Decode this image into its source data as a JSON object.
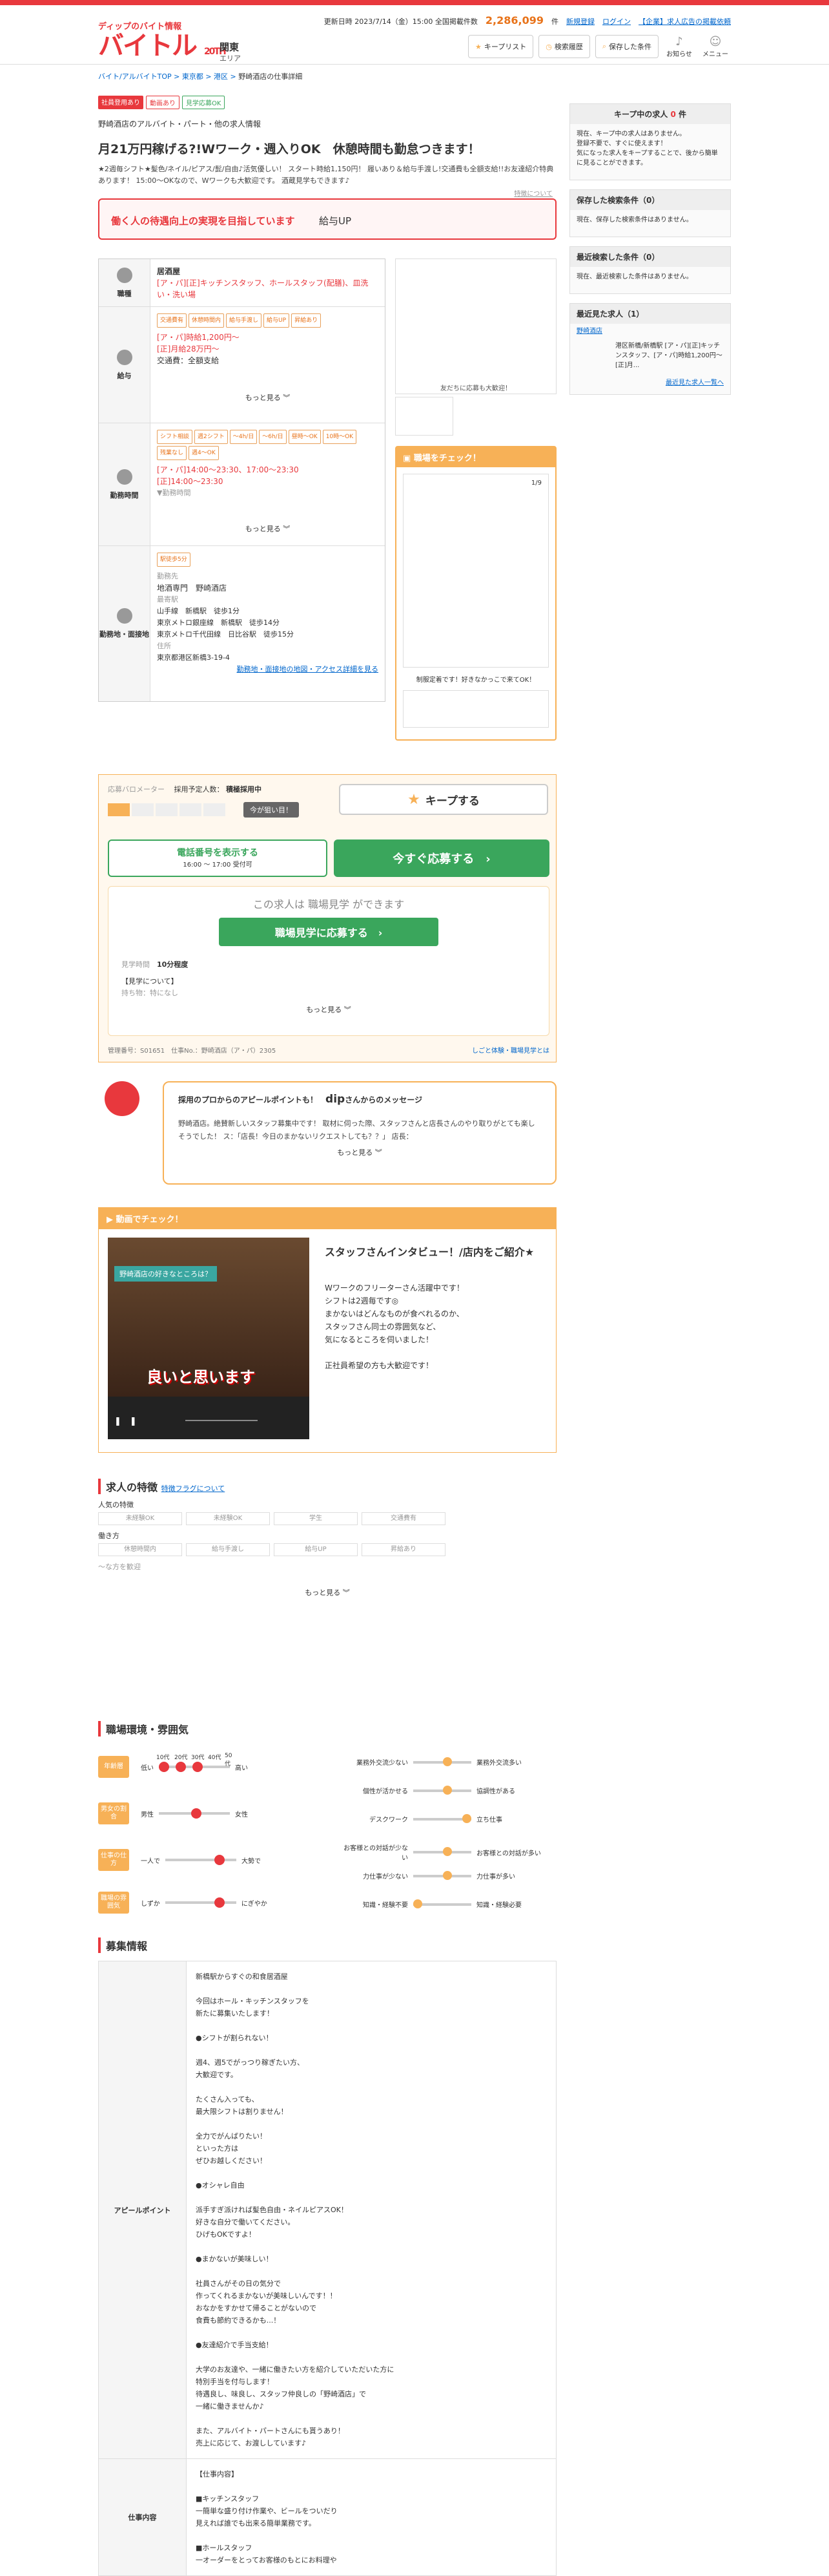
{
  "header": {
    "logo_top": "ディップのバイト情報",
    "logo": "バイトル",
    "logo_sub": "20TH",
    "region": "関東",
    "region_change": "エリア",
    "update_label": "更新日時 2023/7/14（金）15:00 全国掲載件数",
    "count": "2,286,099",
    "count_unit": "件",
    "register": "新規登録",
    "login": "ログイン",
    "corp": "【企業】求人広告の掲載依頼",
    "keep_list": "キープリスト",
    "history": "検索履歴",
    "saved": "保存した条件",
    "notice": "お知らせ",
    "menu": "メニュー"
  },
  "breadcrumb": [
    "バイト/アルバイトTOP",
    "東京都",
    "港区",
    "野崎酒店の仕事詳細"
  ],
  "job": {
    "badges": [
      "社員登用あり",
      "動画あり",
      "見学応募OK"
    ],
    "company": "野崎酒店のアルバイト・パート・他の求人情報",
    "title": "月21万円稼げる?!Wワーク・週入りOK　休憩時間も勤怠つきます！",
    "desc": "★2週毎シフト★髪色/ネイル/ピアス/髭/自由♪活気優しい！ スタート時給1,150円！ 履いあり＆給与手渡し!交通費も全額支給!!お友達紹介特典あります！ 15:00〜OKなので、Wワークも大歓迎です。 酒蔵見学もできます♪",
    "goal_label": "働く人の待遇向上の実現を目指しています",
    "goal_value": "給与UP",
    "goal_link": "特徴について"
  },
  "info": {
    "type_label": "職種",
    "type_tag": "居酒屋",
    "type_value": "[ア・パ][正]キッチンスタッフ、ホールスタッフ(配膳)、皿洗い・洗い場",
    "pay_label": "給与",
    "pay_tags": [
      "交通費有",
      "休憩時間内",
      "給与手渡し",
      "給与UP",
      "昇給あり"
    ],
    "pay_line1": "[ア・パ]時給1,200円〜",
    "pay_line2": "[正]月給28万円〜",
    "pay_line3": "交通費：全額支給",
    "time_label": "勤務時間",
    "time_tags": [
      "シフト相談",
      "週2シフト",
      "〜4h/日",
      "〜6h/日",
      "昼時〜OK",
      "10時〜OK",
      "残業なし",
      "週4〜OK"
    ],
    "time_line1": "[ア・パ]14:00〜23:30、17:00〜23:30",
    "time_line2": "[正]14:00〜23:30",
    "time_line3": "▼勤務時間",
    "place_label": "勤務地・面接地",
    "place_tag": "駅徒歩5分",
    "place_head1": "勤務先",
    "place_name": "地酒専門　野崎酒店",
    "place_head2": "最寄駅",
    "place_st1": "山手線　新橋駅　徒歩1分",
    "place_st2": "東京メトロ銀座線　新橋駅　徒歩14分",
    "place_st3": "東京メトロ千代田線　日比谷駅　徒歩15分",
    "place_head3": "住所",
    "place_addr": "東京都港区新橋3-19-4",
    "place_link": "勤務地・面接地の地図・アクセス詳細を見る",
    "more": "もっと見る"
  },
  "qr": {
    "caption": "友だちに応募も大歓迎！"
  },
  "camera": {
    "title": "職場をチェック！",
    "counter": "1/9",
    "caption": "制服定着です！好きなかっこで来てOK！"
  },
  "sidebar": {
    "keep_title": "キープ中の求人",
    "keep_count": "0",
    "keep_unit": "件",
    "keep_text": "現在、キープ中の求人はありません。\n登録不要で、すぐに使えます！\n気になった求人をキープすることで、後から簡単に見ることができます。",
    "saved_title": "保存した検索条件（0）",
    "saved_text": "現在、保存した検索条件はありません。",
    "recent_cond_title": "最近検索した条件（0）",
    "recent_cond_text": "現在、最近検索した条件はありません。",
    "recent_job_title": "最近見た求人（1）",
    "recent_job_name": "野崎酒店",
    "recent_job_detail": "港区新橋/新橋駅 [ア・パ][正]キッチンスタッフ、[ア・パ]時給1,200円〜[正]月...",
    "recent_job_link": "最近見た求人一覧へ"
  },
  "apply": {
    "meter": "応募バロメーター",
    "plan": "採用予定人数：",
    "plan_value": "積極採用中",
    "hint": "今が狙い目！",
    "keep": "キープする",
    "tel": "電話番号を表示する",
    "tel_time": "16:00 〜 17:00 受付可",
    "now": "今すぐ応募する",
    "visit_title": "この求人は 職場見学 ができます",
    "visit_btn": "職場見学に応募する",
    "visit_time_label": "見学時間",
    "visit_time": "10分程度",
    "visit_about": "【見学について】",
    "visit_about2": "持ち物：特になし",
    "foot_left": "管理番号：S01651　仕事No.：野崎酒店（ア・パ）2305",
    "foot_right": "しごと体験・職場見学とは"
  },
  "message": {
    "lead": "採用のプロからのアピールポイントも！",
    "name": "dip",
    "suffix": "さんからのメッセージ",
    "body": "野崎酒店。絶賛新しいスタッフ募集中です！ 取材に伺った際、スタッフさんと店長さんのやり取りがとても楽しそうでした！ ス：「店長！今日のまかないリクエストしても？？」 店長：",
    "more": "もっと見る"
  },
  "video": {
    "title": "動画でチェック！",
    "cap1": "野崎酒店の好きなところは？",
    "cap2": "良いと思います",
    "heading": "スタッフさんインタビュー！/店内をご紹介★",
    "text1": "Wワークのフリーターさん活躍中です！",
    "text2": "シフトは2週毎です◎",
    "text3": "まかないはどんなものが食べれるのか、",
    "text4": "スタッフさん同士の雰囲気など、",
    "text5": "気になるところを伺いました！",
    "text6": "正社員希望の方も大歓迎です！"
  },
  "features": {
    "title": "求人の特徴",
    "link": "特徴フラグについて",
    "g1": "人気の特徴",
    "g1_items": [
      "未経験OK",
      "未経験OK",
      "学生",
      "交通費有"
    ],
    "g2": "働き方",
    "g2_items": [
      "休憩時間内",
      "給与手渡し",
      "給与UP",
      "昇給あり"
    ],
    "g3": "〜な方を歓迎",
    "more": "もっと見る"
  },
  "env": {
    "title": "職場環境・雰囲気",
    "age_tag": "年齢層",
    "ages": [
      "10代",
      "20代",
      "30代",
      "40代",
      "50代"
    ],
    "age_low": "低い",
    "age_high": "高い",
    "sex_tag": "男女の割合",
    "sex_l": "男性",
    "sex_r": "女性",
    "style_tag": "仕事の仕方",
    "style_l": "一人で",
    "style_r": "大勢で",
    "mood_tag": "職場の雰囲気",
    "mood_l": "しずか",
    "mood_r": "にぎやか",
    "r1_l": "業務外交流少ない",
    "r1_r": "業務外交流多い",
    "r2_l": "個性が活かせる",
    "r2_r": "協調性がある",
    "r3_l": "デスクワーク",
    "r3_r": "立ち仕事",
    "r4_l": "お客様との対話が少ない",
    "r4_r": "お客様との対話が多い",
    "r5_l": "力仕事が少ない",
    "r5_r": "力仕事が多い",
    "r6_l": "知識・経験不要",
    "r6_r": "知識・経験必要"
  },
  "recruit": {
    "title": "募集情報",
    "label": "アピールポイント",
    "body": "新橋駅からすぐの和食居酒屋\n\n今回はホール・キッチンスタッフを\n新たに募集いたします！\n\n●シフトが割られない！\n\n週4、週5でがっつり稼ぎたい方、\n大歓迎です。\n\nたくさん入っても、\n最大限シフトは割りません！\n\n全力でがんばりたい！\nといった方は\nぜひお越しください！\n\n●オシャレ自由\n\n派手すぎ派ければ髪色自由・ネイルピアスOK！\n好きな自分で働いてください。\nひげもOKですよ！\n\n●まかないが美味しい！\n\n社員さんがその日の気分で\n作ってくれるまかないが美味しいんです！！\nおなかをすかせて帰ることがないので\n食費も節約できるかも...！\n\n●友達紹介で手当支給！\n\n大学のお友達や、一緒に働きたい方を紹介していただいた方に\n特別手当を付与します！\n待遇良し、味良し、スタッフ仲良しの「野崎酒店」で\n一緒に働きませんか♪\n\nまた、アルバイト・パートさんにも貰うあり！\n売上に応じて、お渡ししています♪",
    "label2": "仕事内容",
    "body2": "【仕事内容】\n\n■キッチンスタッフ\n一簡単な盛り付け作業や、ビールをついだり\n見えれば誰でも出来る簡単業務です。\n\n■ホールスタッフ\n一オーダーをとってお客様のもとにお料理や"
  },
  "colors": {
    "brand": "#e8383d",
    "accent": "#f7b157",
    "green": "#3aa65c"
  }
}
